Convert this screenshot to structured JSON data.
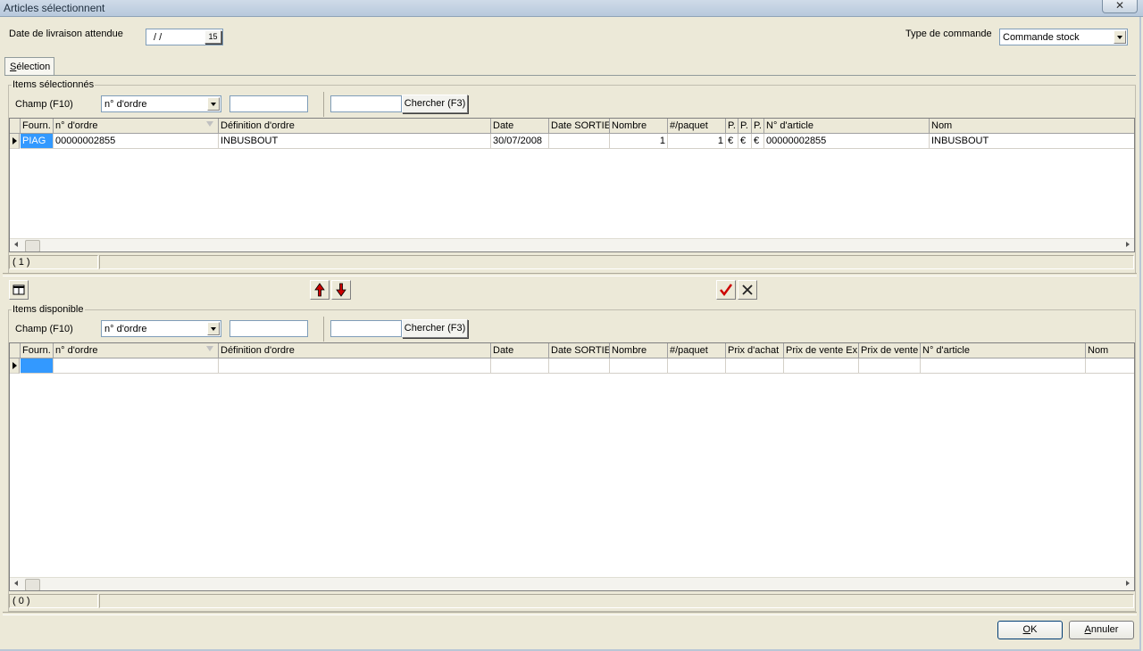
{
  "window": {
    "title": "Articles sélectionnent",
    "close_glyph": "✕"
  },
  "header": {
    "delivery_label": "Date de livraison attendue",
    "delivery_value": "/ /",
    "calendar_label": "15",
    "order_type_label": "Type de commande",
    "order_type_value": "Commande stock"
  },
  "tab": {
    "label_first": "S",
    "label_rest": "élection"
  },
  "selected": {
    "group_title": "Items sélectionnés",
    "field_label": "Champ (F10)",
    "field_value": "n° d'ordre",
    "search_button": "Chercher (F3)",
    "columns": [
      "Fourn.",
      "n° d'ordre",
      "Définition d'ordre",
      "Date",
      "Date SORTIE",
      "Nombre",
      "#/paquet",
      "P.",
      "P.",
      "P.",
      "N° d'article",
      "Nom"
    ],
    "rows": [
      [
        "PIAG",
        "00000002855",
        "INBUSBOUT",
        "30/07/2008",
        "",
        "1",
        "1",
        "€",
        "€",
        "€",
        "00000002855",
        "INBUSBOUT"
      ]
    ],
    "count": "( 1 )"
  },
  "middle_toolbar": {
    "up_icon": "up-arrow-icon",
    "down_icon": "down-arrow-icon",
    "confirm_icon": "checkmark-icon",
    "cancel_icon": "cross-icon",
    "columns_icon": "columns-icon"
  },
  "available": {
    "group_title": "Items disponible",
    "field_label": "Champ (F10)",
    "field_value": "n° d'ordre",
    "search_button": "Chercher (F3)",
    "columns": [
      "Fourn.",
      "n° d'ordre",
      "Définition d'ordre",
      "Date",
      "Date SORTIE",
      "Nombre",
      "#/paquet",
      "Prix d'achat",
      "Prix de vente Ex",
      "Prix de vente",
      "N° d'article",
      "Nom"
    ],
    "count": "( 0 )"
  },
  "footer": {
    "ok_first": "O",
    "ok_rest": "K",
    "cancel_first": "A",
    "cancel_rest": "nnuler"
  },
  "colors": {
    "selection": "#3399ff",
    "check": "#cc0000",
    "arrow": "#cc0000"
  }
}
